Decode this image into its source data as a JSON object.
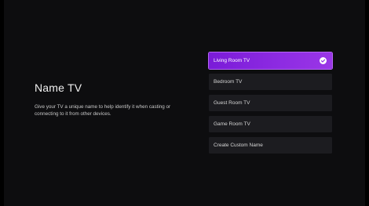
{
  "page": {
    "title": "Name TV",
    "description": "Give your TV a unique name to help identify it when casting or connecting to it from other devices."
  },
  "options": [
    {
      "label": "Living Room TV",
      "selected": true
    },
    {
      "label": "Bedroom TV",
      "selected": false
    },
    {
      "label": "Guest Room TV",
      "selected": false
    },
    {
      "label": "Game Room TV",
      "selected": false
    },
    {
      "label": "Create Custom Name",
      "selected": false
    }
  ],
  "colors": {
    "background": "#000000",
    "accent": "#8e2ce2",
    "option_background": "#1c1c20"
  },
  "icons": {
    "selected_marker": "check-circle-icon"
  }
}
